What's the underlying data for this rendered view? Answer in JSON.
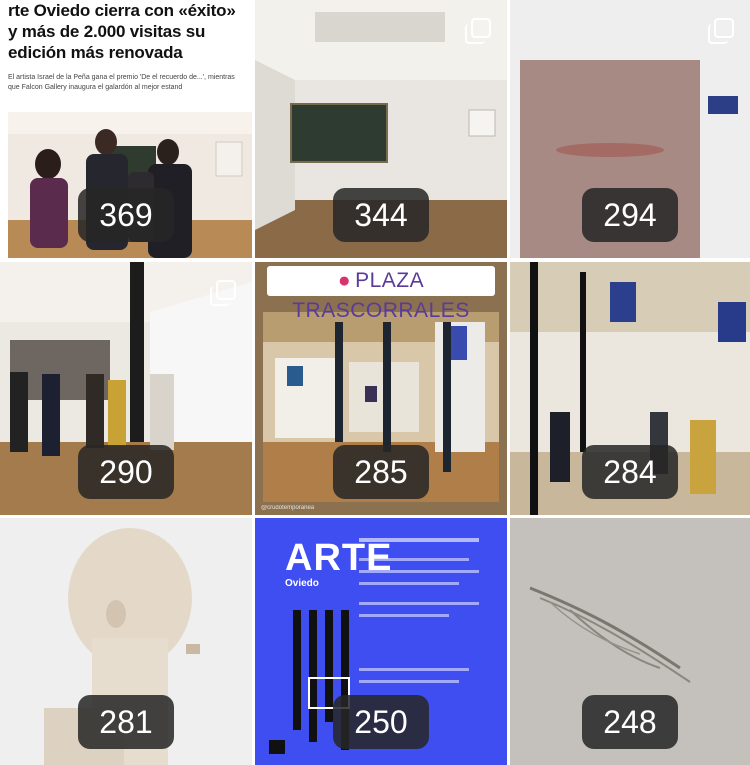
{
  "posts": [
    {
      "count": "369",
      "headline": "rte Oviedo cierra con «éxito» y más de 2.000 visitas su edición más renovada",
      "subhead": "El artista Israel de la Peña gana el premio 'De el recuerdo de...', mientras que Falcon Gallery inaugura el galardón al mejor estand",
      "multiple": false
    },
    {
      "count": "344",
      "multiple": true
    },
    {
      "count": "294",
      "multiple": true
    },
    {
      "count": "290",
      "multiple": true
    },
    {
      "count": "285",
      "banner": "PLAZA TRASCORRALES",
      "footer": "@crudotemporanea",
      "multiple": false
    },
    {
      "count": "284",
      "multiple": false
    },
    {
      "count": "281",
      "multiple": false
    },
    {
      "count": "250",
      "poster_title": "ARTE",
      "poster_sub": "Oviedo",
      "multiple": false
    },
    {
      "count": "248",
      "multiple": false
    }
  ],
  "colors": {
    "badge_bg": "#262626",
    "badge_text": "#ffffff",
    "poster_blue": "#3f4ef0",
    "banner_purple": "#5a3a9a"
  }
}
